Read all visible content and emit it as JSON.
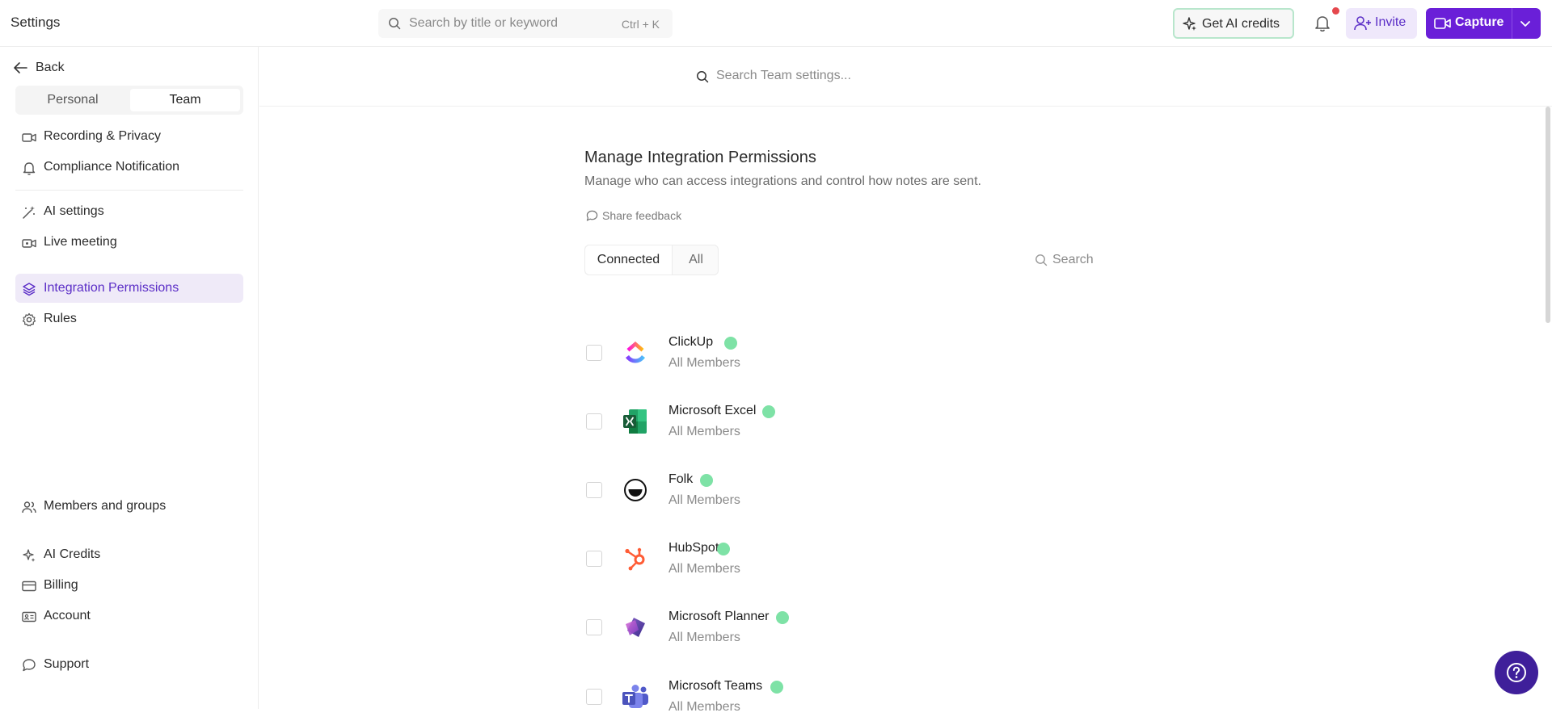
{
  "app": {
    "title": "Settings"
  },
  "topbar": {
    "search_placeholder": "Search by title or keyword",
    "search_shortcut": "Ctrl + K",
    "credits_label": "Get AI credits",
    "invite_label": "Invite",
    "capture_label": "Capture",
    "notification_dot": true
  },
  "sidebar": {
    "back_label": "Back",
    "scope_tabs": [
      "Personal",
      "Team"
    ],
    "active_scope": "Team",
    "items": [
      {
        "label": "Recording & Privacy",
        "icon": "video-camera-icon"
      },
      {
        "label": "Compliance Notification",
        "icon": "bell-icon"
      },
      {
        "label": "AI settings",
        "icon": "magic-wand-icon"
      },
      {
        "label": "Live meeting",
        "icon": "video-call-icon"
      },
      {
        "label": "Integration Permissions",
        "icon": "layers-icon",
        "active": true
      },
      {
        "label": "Rules",
        "icon": "gear-icon"
      },
      {
        "label": "Members and groups",
        "icon": "users-icon"
      },
      {
        "label": "AI Credits",
        "icon": "sparkle-icon"
      },
      {
        "label": "Billing",
        "icon": "credit-card-icon"
      },
      {
        "label": "Account",
        "icon": "id-card-icon"
      },
      {
        "label": "Support",
        "icon": "chat-bubble-icon"
      }
    ]
  },
  "main": {
    "settings_search_placeholder": "Search Team settings...",
    "title": "Manage Integration Permissions",
    "subtitle": "Manage who can access integrations and control how notes are sent.",
    "feedback_label": "Share feedback",
    "tabs": [
      "Connected",
      "All"
    ],
    "active_tab": "Connected",
    "search_placeholder": "Search",
    "integrations": [
      {
        "name": "ClickUp",
        "access": "All Members",
        "connected": true,
        "logo": "clickup-logo-icon"
      },
      {
        "name": "Microsoft Excel",
        "access": "All Members",
        "connected": true,
        "logo": "excel-logo-icon"
      },
      {
        "name": "Folk",
        "access": "All Members",
        "connected": true,
        "logo": "folk-logo-icon"
      },
      {
        "name": "HubSpot",
        "access": "All Members",
        "connected": true,
        "logo": "hubspot-logo-icon"
      },
      {
        "name": "Microsoft Planner",
        "access": "All Members",
        "connected": true,
        "logo": "planner-logo-icon"
      },
      {
        "name": "Microsoft Teams",
        "access": "All Members",
        "connected": true,
        "logo": "teams-logo-icon"
      }
    ]
  },
  "colors": {
    "accent": "#6a1fd8",
    "accent_light": "#efeaf8",
    "connected_dot": "#7ee2a6",
    "help_button": "#3f1f9a"
  }
}
